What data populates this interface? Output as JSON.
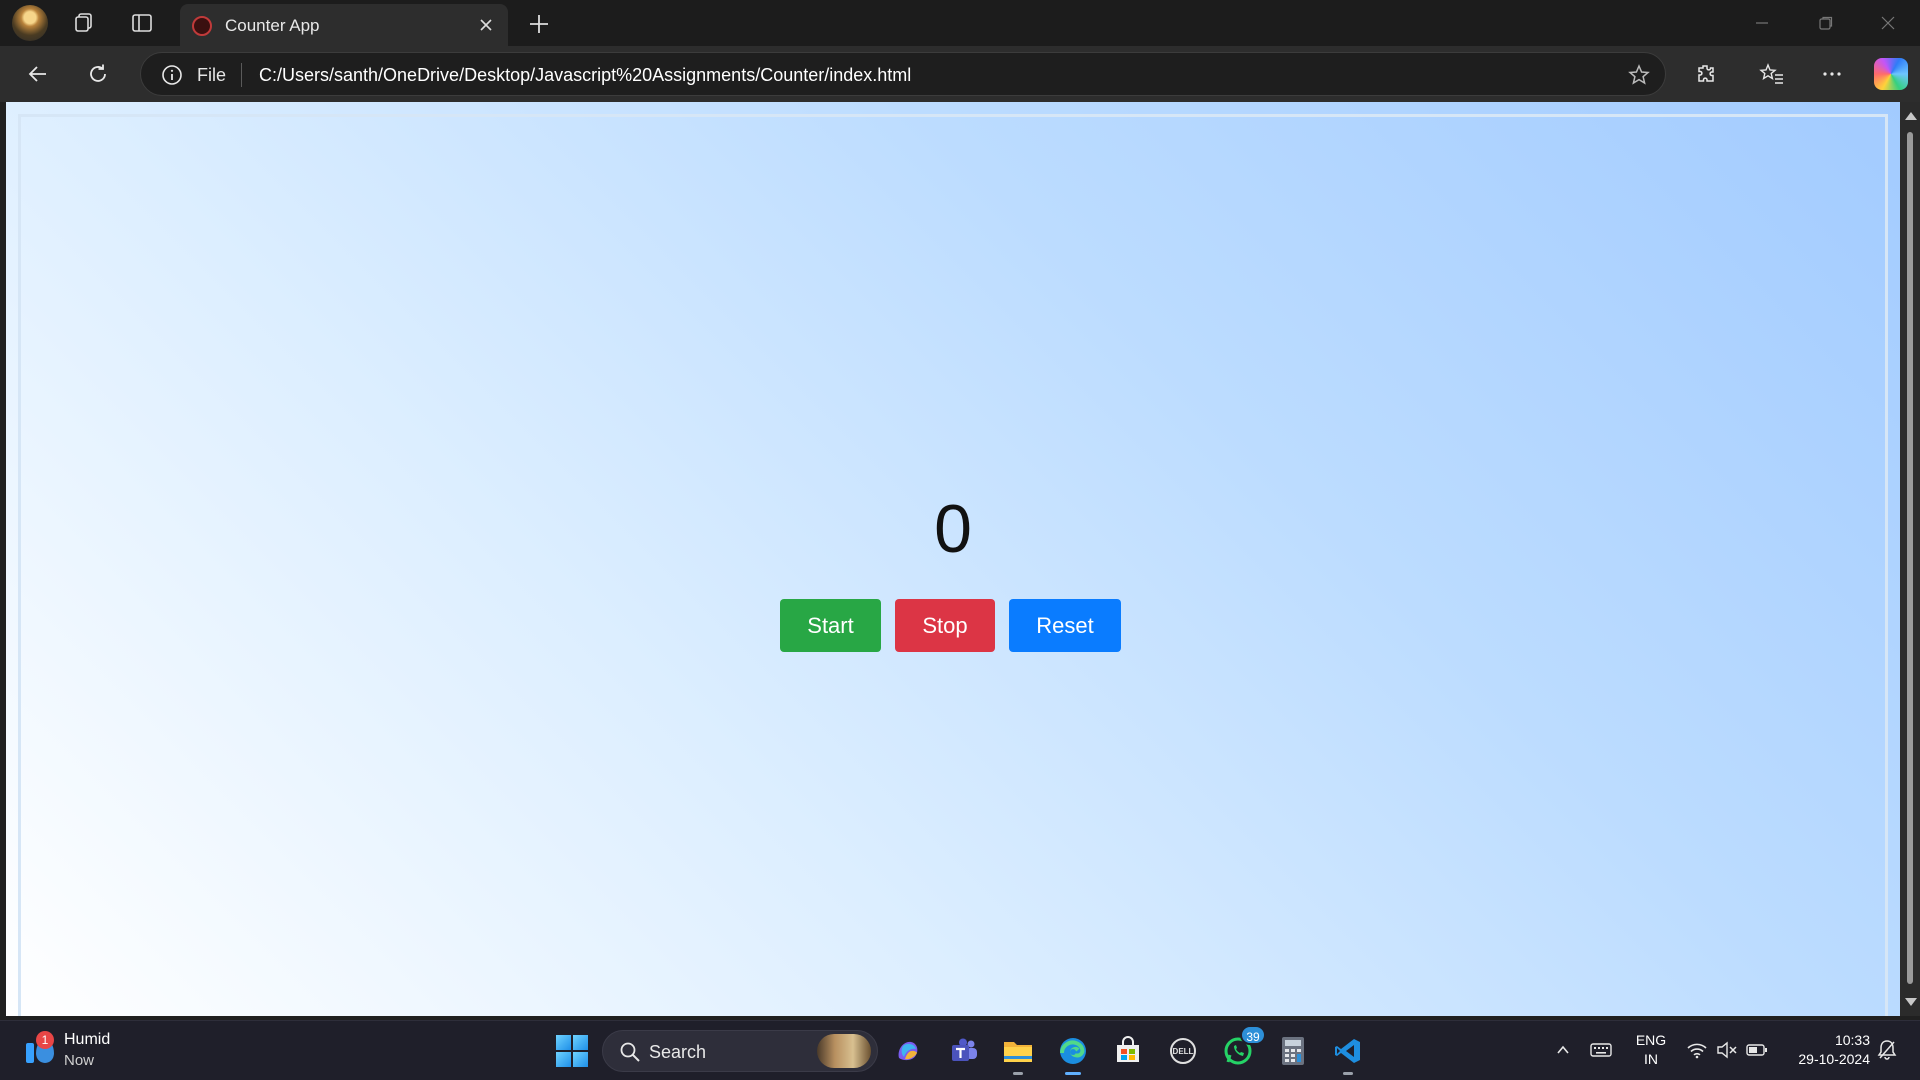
{
  "browser": {
    "tab": {
      "title": "Counter App"
    },
    "address_bar": {
      "scheme_label": "File",
      "url": "C:/Users/santh/OneDrive/Desktop/Javascript%20Assignments/Counter/index.html"
    }
  },
  "page": {
    "counter_value": "0",
    "buttons": {
      "start": "Start",
      "stop": "Stop",
      "reset": "Reset"
    },
    "colors": {
      "start": "#28a745",
      "stop": "#dc3545",
      "reset": "#0a7cff"
    }
  },
  "taskbar": {
    "widget": {
      "title": "Humid",
      "subtitle": "Now",
      "badge": "1"
    },
    "search": {
      "placeholder": "Search"
    },
    "whatsapp_badge": "39",
    "language": {
      "line1": "ENG",
      "line2": "IN"
    },
    "clock": {
      "time": "10:33",
      "date": "29-10-2024"
    }
  }
}
